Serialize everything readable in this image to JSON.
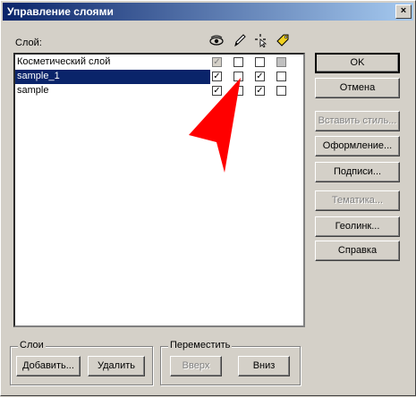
{
  "window": {
    "title": "Управление слоями",
    "close_label": "×"
  },
  "layers_label": "Слой:",
  "column_icons": [
    "eye-icon",
    "pencil-icon",
    "cursor-select-icon",
    "label-tag-icon"
  ],
  "layers": [
    {
      "name": "Косметический слой",
      "visible": true,
      "editable": false,
      "selectable": false,
      "labels": false
    },
    {
      "name": "sample_1",
      "visible": true,
      "editable": false,
      "selectable": true,
      "labels": false
    },
    {
      "name": "sample",
      "visible": true,
      "editable": false,
      "selectable": true,
      "labels": false
    }
  ],
  "buttons": {
    "ok": "OK",
    "cancel": "Отмена",
    "paste_style": "Вставить стиль...",
    "appearance": "Оформление...",
    "labels": "Подписи...",
    "thematic": "Тематика...",
    "geolink": "Геолинк...",
    "help": "Справка"
  },
  "group_layers": {
    "caption": "Слои",
    "add": "Добавить...",
    "delete": "Удалить"
  },
  "group_move": {
    "caption": "Переместить",
    "up": "Вверх",
    "down": "Вниз"
  },
  "check_mark": "✓",
  "accent": {
    "titlebar": "#0a246a",
    "selection": "#0a246a",
    "arrow": "#ff0000"
  }
}
